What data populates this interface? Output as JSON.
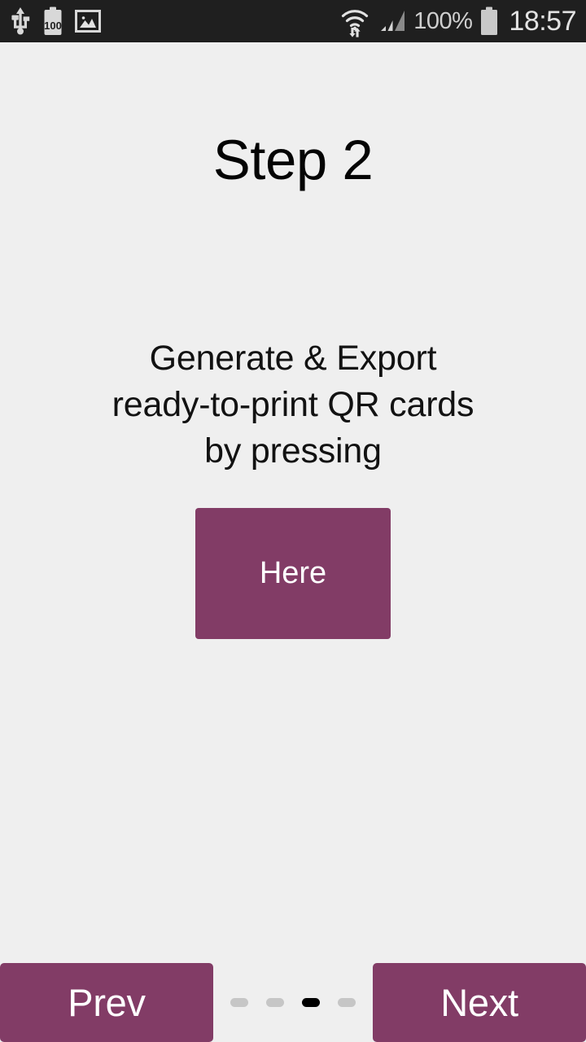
{
  "status_bar": {
    "background_color": "#1f1f1f",
    "left_icons": [
      {
        "name": "usb-icon",
        "label": "USB"
      },
      {
        "name": "battery-charge-icon",
        "label": "100"
      },
      {
        "name": "gallery-image-icon",
        "label": "Image"
      }
    ],
    "right_icons": [
      {
        "name": "wifi-transfer-icon",
        "label": "Wi-Fi"
      },
      {
        "name": "cell-signal-icon",
        "label": "Signal"
      }
    ],
    "battery_percent": "100%",
    "battery_icon": "battery-full-icon",
    "clock": "18:57"
  },
  "page": {
    "background_color": "#efefef",
    "title": "Step 2",
    "body_lines": [
      "Generate & Export",
      "ready-to-print QR cards",
      "by pressing"
    ],
    "primary_button": {
      "label": "Here",
      "color": "#823c66",
      "text_color": "#ffffff"
    }
  },
  "bottom_nav": {
    "prev_label": "Prev",
    "next_label": "Next",
    "button_color": "#823c66",
    "dots": [
      {
        "active": false
      },
      {
        "active": false
      },
      {
        "active": true
      },
      {
        "active": false
      }
    ],
    "active_dot_color": "#000000",
    "inactive_dot_color": "#c6c6c6"
  }
}
